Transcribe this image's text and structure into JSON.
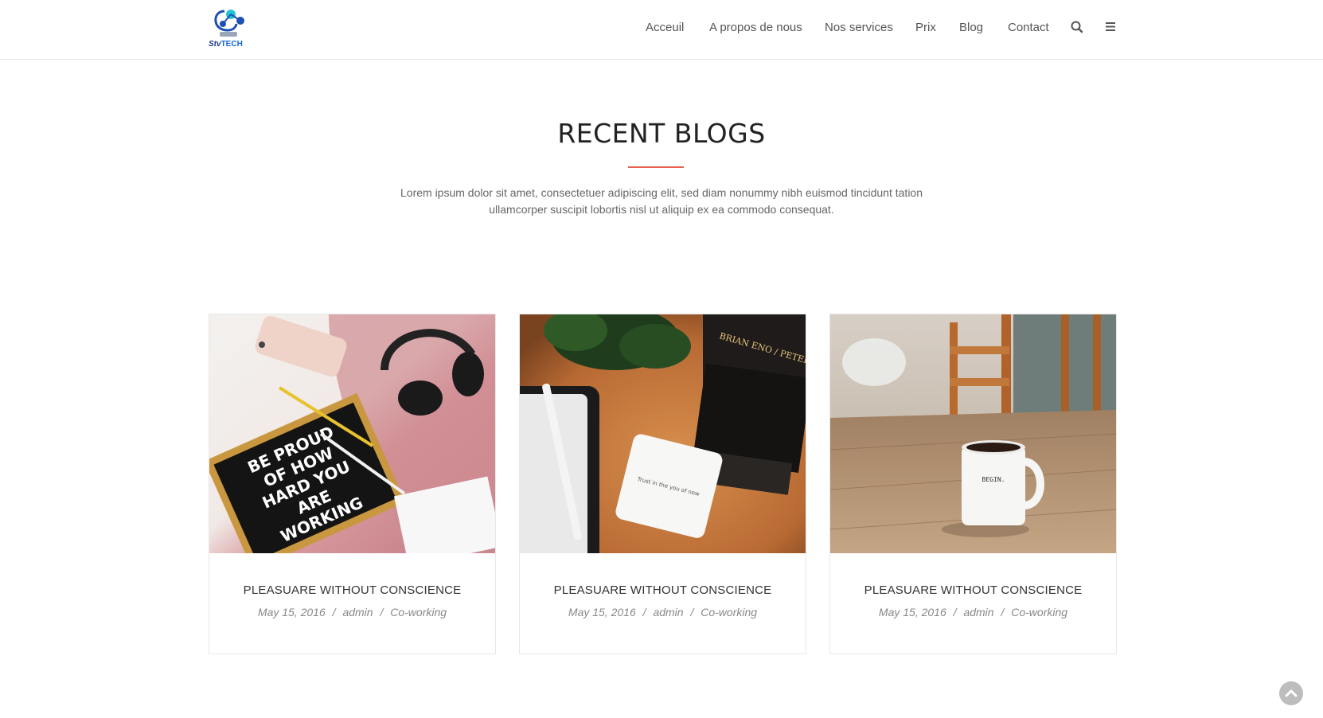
{
  "logo": {
    "text_a": "Stv",
    "text_b": "TECH",
    "icon": "logo-icon"
  },
  "nav": {
    "items": [
      {
        "label": "Acceuil"
      },
      {
        "label": "A propos de nous"
      },
      {
        "label": "Nos services"
      },
      {
        "label": "Prix"
      },
      {
        "label": "Blog"
      },
      {
        "label": "Contact"
      }
    ],
    "search_icon": "search-icon",
    "menu_icon": "hamburger-menu-icon"
  },
  "section": {
    "title": "RECENT BLOGS",
    "description_line1": "Lorem ipsum dolor sit amet, consectetuer adipiscing elit, sed diam nonummy nibh euismod tincidunt tation",
    "description_line2": "ullamcorper suscipit lobortis nisl ut aliquip ex ea commodo consequat."
  },
  "colors": {
    "accent": "#e8604c",
    "text_dark": "#222222",
    "text_muted": "#888888"
  },
  "cards": [
    {
      "title": "PLEASUARE WITHOUT CONSCIENCE",
      "date": "May 15, 2016",
      "author": "admin",
      "category": "Co-working",
      "image": {
        "board_lines": [
          "BE PROUD",
          "OF HOW",
          "HARD YOU",
          "ARE",
          "WORKING"
        ]
      }
    },
    {
      "title": "PLEASUARE WITHOUT CONSCIENCE",
      "date": "May 15, 2016",
      "author": "admin",
      "category": "Co-working",
      "image": {
        "book_text": "BRIAN ENO / PETER SCH",
        "card_text": "Trust in the you of now"
      }
    },
    {
      "title": "PLEASUARE WITHOUT CONSCIENCE",
      "date": "May 15, 2016",
      "author": "admin",
      "category": "Co-working",
      "image": {
        "mug_text": "BEGIN."
      }
    }
  ],
  "meta_separator": "/",
  "scroll_top_icon": "chevron-up-icon"
}
